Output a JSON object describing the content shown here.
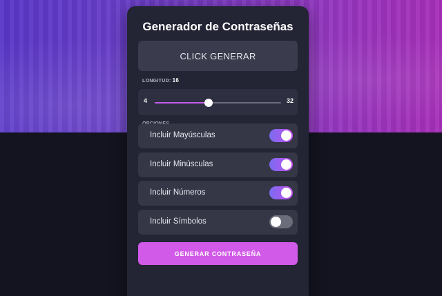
{
  "app": {
    "title": "Generador de Contraseñas"
  },
  "password_display": {
    "text": "CLICK GENERAR"
  },
  "length": {
    "label": "LONGITUD:",
    "value": "16",
    "min": "4",
    "max": "32",
    "current": 16,
    "min_value": 4,
    "max_value": 32
  },
  "options": {
    "label": "OPCIONES",
    "items": [
      {
        "label": "Incluir Mayúsculas",
        "enabled": true
      },
      {
        "label": "Incluir Minúsculas",
        "enabled": true
      },
      {
        "label": "Incluir Números",
        "enabled": true
      },
      {
        "label": "Incluir Símbolos",
        "enabled": false
      }
    ]
  },
  "generate_button": {
    "label": "GENERAR CONTRASEÑA"
  },
  "colors": {
    "background": "#13141f",
    "card": "#232434",
    "accent": "#d25ae8",
    "toggle_on_start": "#7a6cf0",
    "toggle_on_end": "#c24ff0",
    "toggle_off": "#6c6d7a"
  }
}
